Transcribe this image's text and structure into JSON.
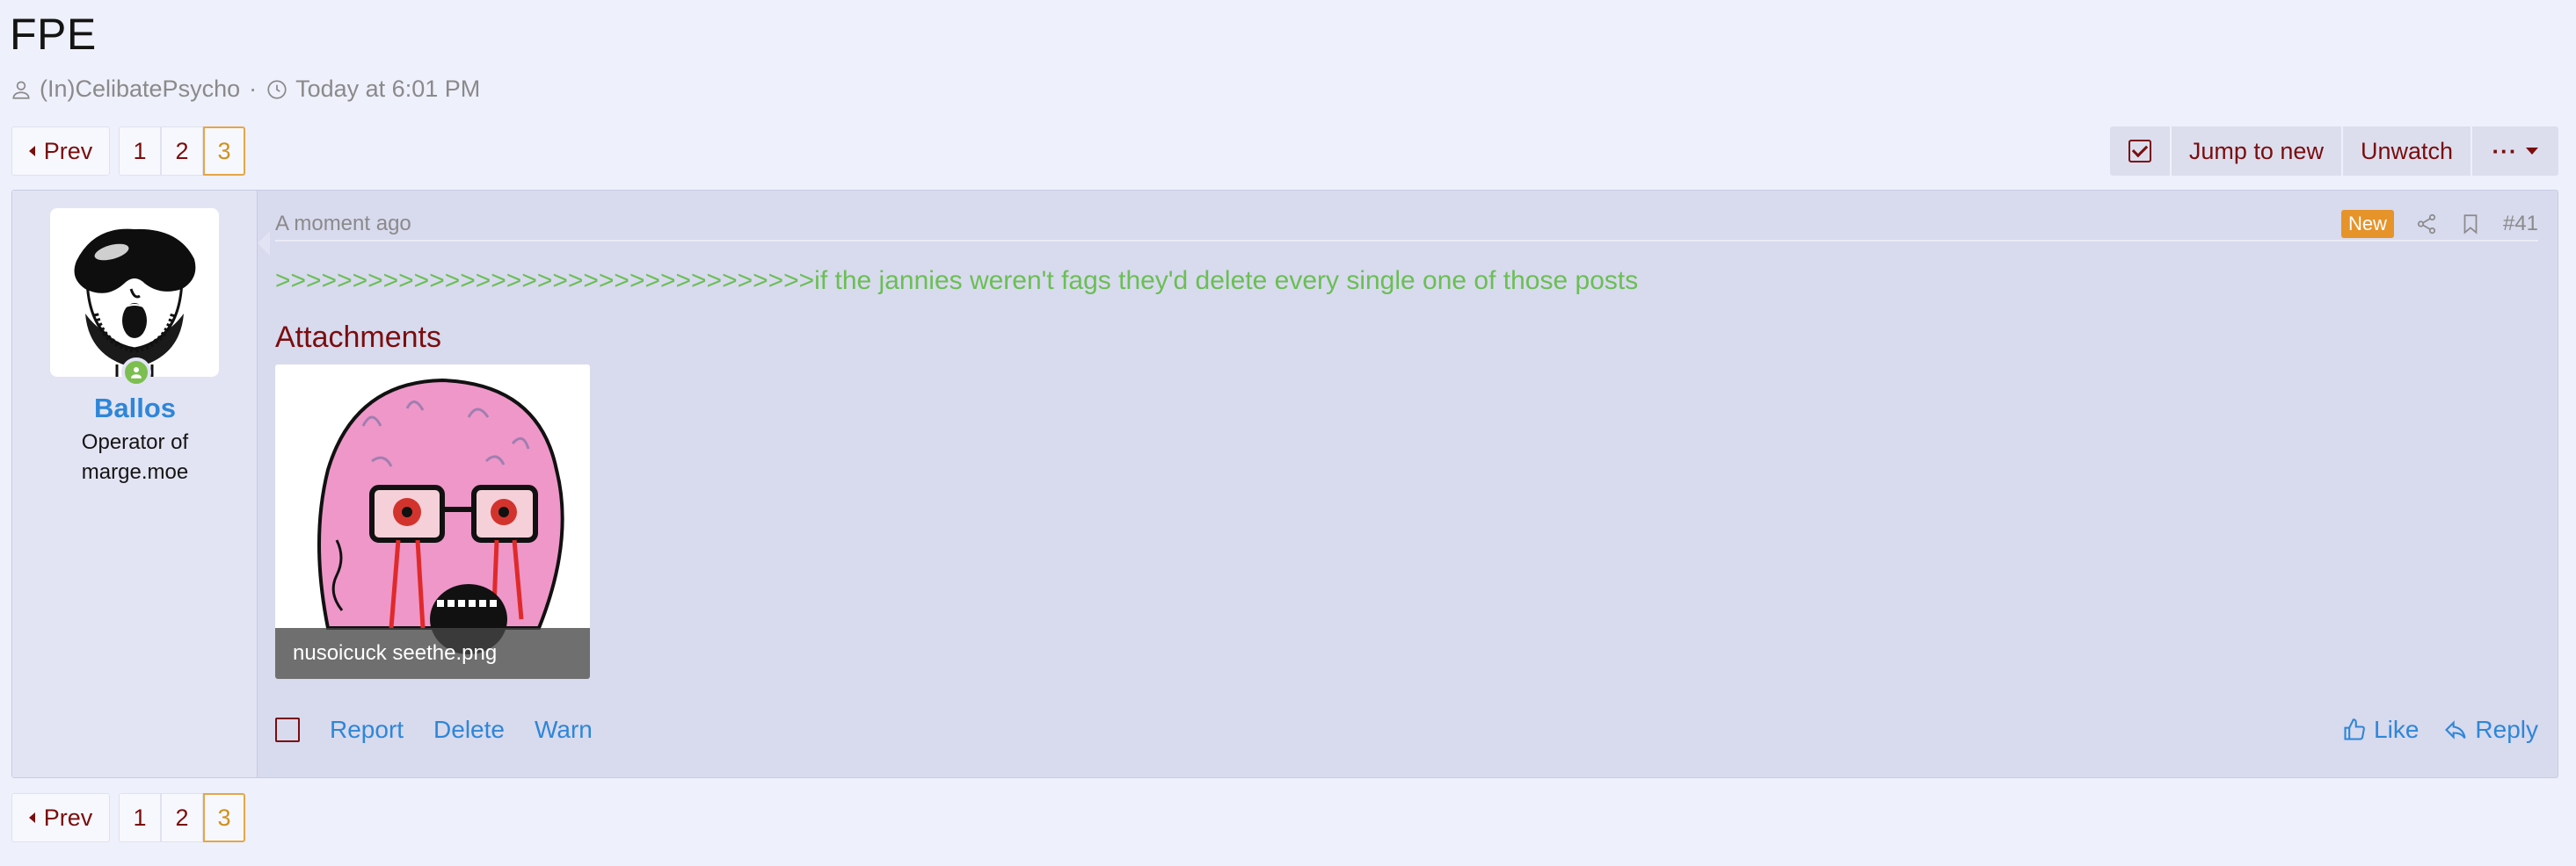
{
  "thread": {
    "title": "FPE",
    "author": "(In)CelibatePsycho",
    "separator": "·",
    "time": "Today at 6:01 PM"
  },
  "pager": {
    "prev_label": "Prev",
    "pages": [
      "1",
      "2",
      "3"
    ],
    "current": "3"
  },
  "toolbar": {
    "jump_label": "Jump to new",
    "unwatch_label": "Unwatch",
    "more_label": "···"
  },
  "post": {
    "username": "Ballos",
    "user_title": "Operator of marge.moe",
    "time": "A moment ago",
    "badge": "New",
    "number": "#41",
    "greentext": ">>>>>>>>>>>>>>>>>>>>>>>>>>>>>>>>>>>if the jannies weren't fags they'd delete every single one of those posts",
    "attachments_title": "Attachments",
    "attachment_name": "nusoicuck seethe.png",
    "actions": {
      "report": "Report",
      "delete": "Delete",
      "warn": "Warn",
      "like": "Like",
      "reply": "Reply"
    }
  },
  "icons": {
    "author": "user-icon",
    "clock": "clock-icon",
    "share": "share-icon",
    "bookmark": "bookmark-icon",
    "like": "thumbs-up-icon",
    "reply": "reply-icon",
    "online": "online-status-icon"
  },
  "colors": {
    "background": "#eef0fb",
    "post_bg": "#d8daee",
    "link": "#2e86d8",
    "brand": "#7a0d0d",
    "greentext": "#6abf53",
    "new_badge": "#e6932a",
    "current_page": "#d0911c"
  }
}
